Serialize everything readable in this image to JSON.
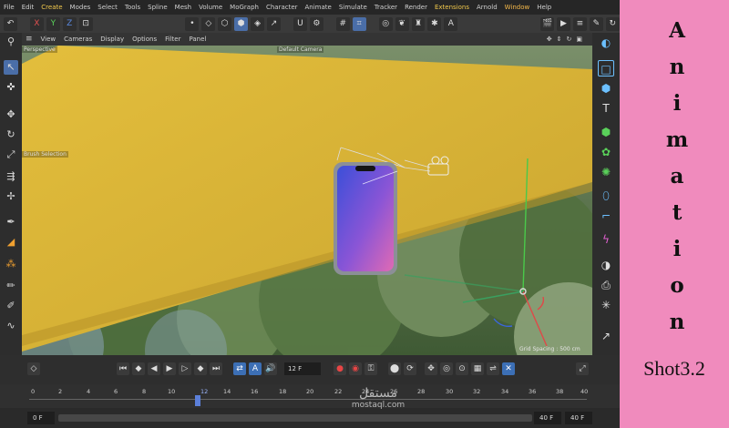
{
  "menubar": {
    "items": [
      "File",
      "Edit",
      "Create",
      "Modes",
      "Select",
      "Tools",
      "Spline",
      "Mesh",
      "Volume",
      "MoGraph",
      "Character",
      "Animate",
      "Simulate",
      "Tracker",
      "Render",
      "Extensions",
      "Arnold",
      "Window",
      "Help"
    ]
  },
  "toolbar": {
    "x": "X",
    "y": "Y",
    "z": "Z"
  },
  "viewport_menu": {
    "items": [
      "View",
      "Cameras",
      "Display",
      "Options",
      "Filter",
      "Panel"
    ]
  },
  "viewport": {
    "view_name": "Perspective",
    "camera_name": "Default Camera",
    "brush_label": "Brush Selection",
    "grid_spacing": "Grid Spacing : 500 cm"
  },
  "timeline": {
    "current_frame": "12 F",
    "ticks": [
      "0",
      "2",
      "4",
      "6",
      "8",
      "10",
      "12",
      "14",
      "16",
      "18",
      "20",
      "22",
      "24",
      "26",
      "28",
      "30",
      "32",
      "34",
      "36",
      "38",
      "40"
    ],
    "start_field": "0 F",
    "end_field_a": "40 F",
    "end_field_b": "40 F"
  },
  "watermark": {
    "arabic": "مستقل",
    "latin": "mostaql.com"
  },
  "side_panel": {
    "letters": [
      "A",
      "n",
      "i",
      "m",
      "a",
      "t",
      "i",
      "o",
      "n"
    ],
    "shot": "Shot3.2"
  },
  "colors": {
    "panel_pink": "#f08bbd",
    "plane_yellow": "#e7c13f",
    "accent_blue": "#4a6ea8"
  }
}
